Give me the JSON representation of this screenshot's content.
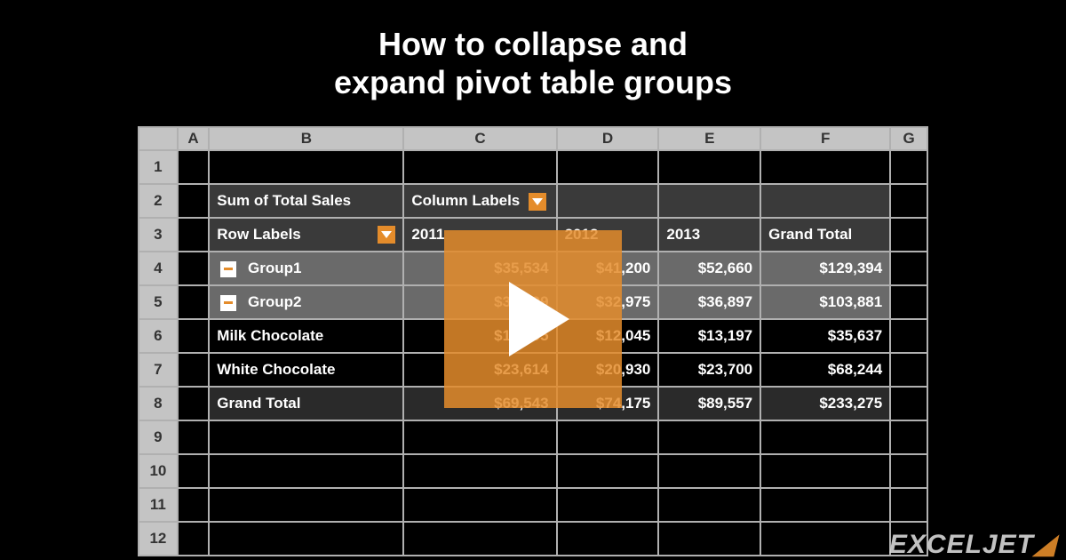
{
  "title_line1": "How to collapse and",
  "title_line2": "expand pivot table groups",
  "columns": [
    "A",
    "B",
    "C",
    "D",
    "E",
    "F",
    "G"
  ],
  "row_numbers": [
    "1",
    "2",
    "3",
    "4",
    "5",
    "6",
    "7",
    "8",
    "9",
    "10",
    "11",
    "12"
  ],
  "pivot": {
    "sum_label": "Sum of Total Sales",
    "column_labels_text": "Column Labels",
    "row_labels_text": "Row Labels",
    "years": [
      "2011",
      "2012",
      "2013"
    ],
    "grand_total_col": "Grand Total",
    "rows": [
      {
        "type": "group",
        "label": "Group1",
        "values": [
          "$35,534",
          "$41,200",
          "$52,660",
          "$129,394"
        ]
      },
      {
        "type": "group",
        "label": "Group2",
        "values": [
          "$34,009",
          "$32,975",
          "$36,897",
          "$103,881"
        ]
      },
      {
        "type": "detail",
        "label": "Milk Chocolate",
        "values": [
          "$10,395",
          "$12,045",
          "$13,197",
          "$35,637"
        ]
      },
      {
        "type": "detail",
        "label": "White Chocolate",
        "values": [
          "$23,614",
          "$20,930",
          "$23,700",
          "$68,244"
        ]
      },
      {
        "type": "total",
        "label": "Grand Total",
        "values": [
          "$69,543",
          "$74,175",
          "$89,557",
          "$233,275"
        ]
      }
    ]
  },
  "watermark": "EXCELJET"
}
